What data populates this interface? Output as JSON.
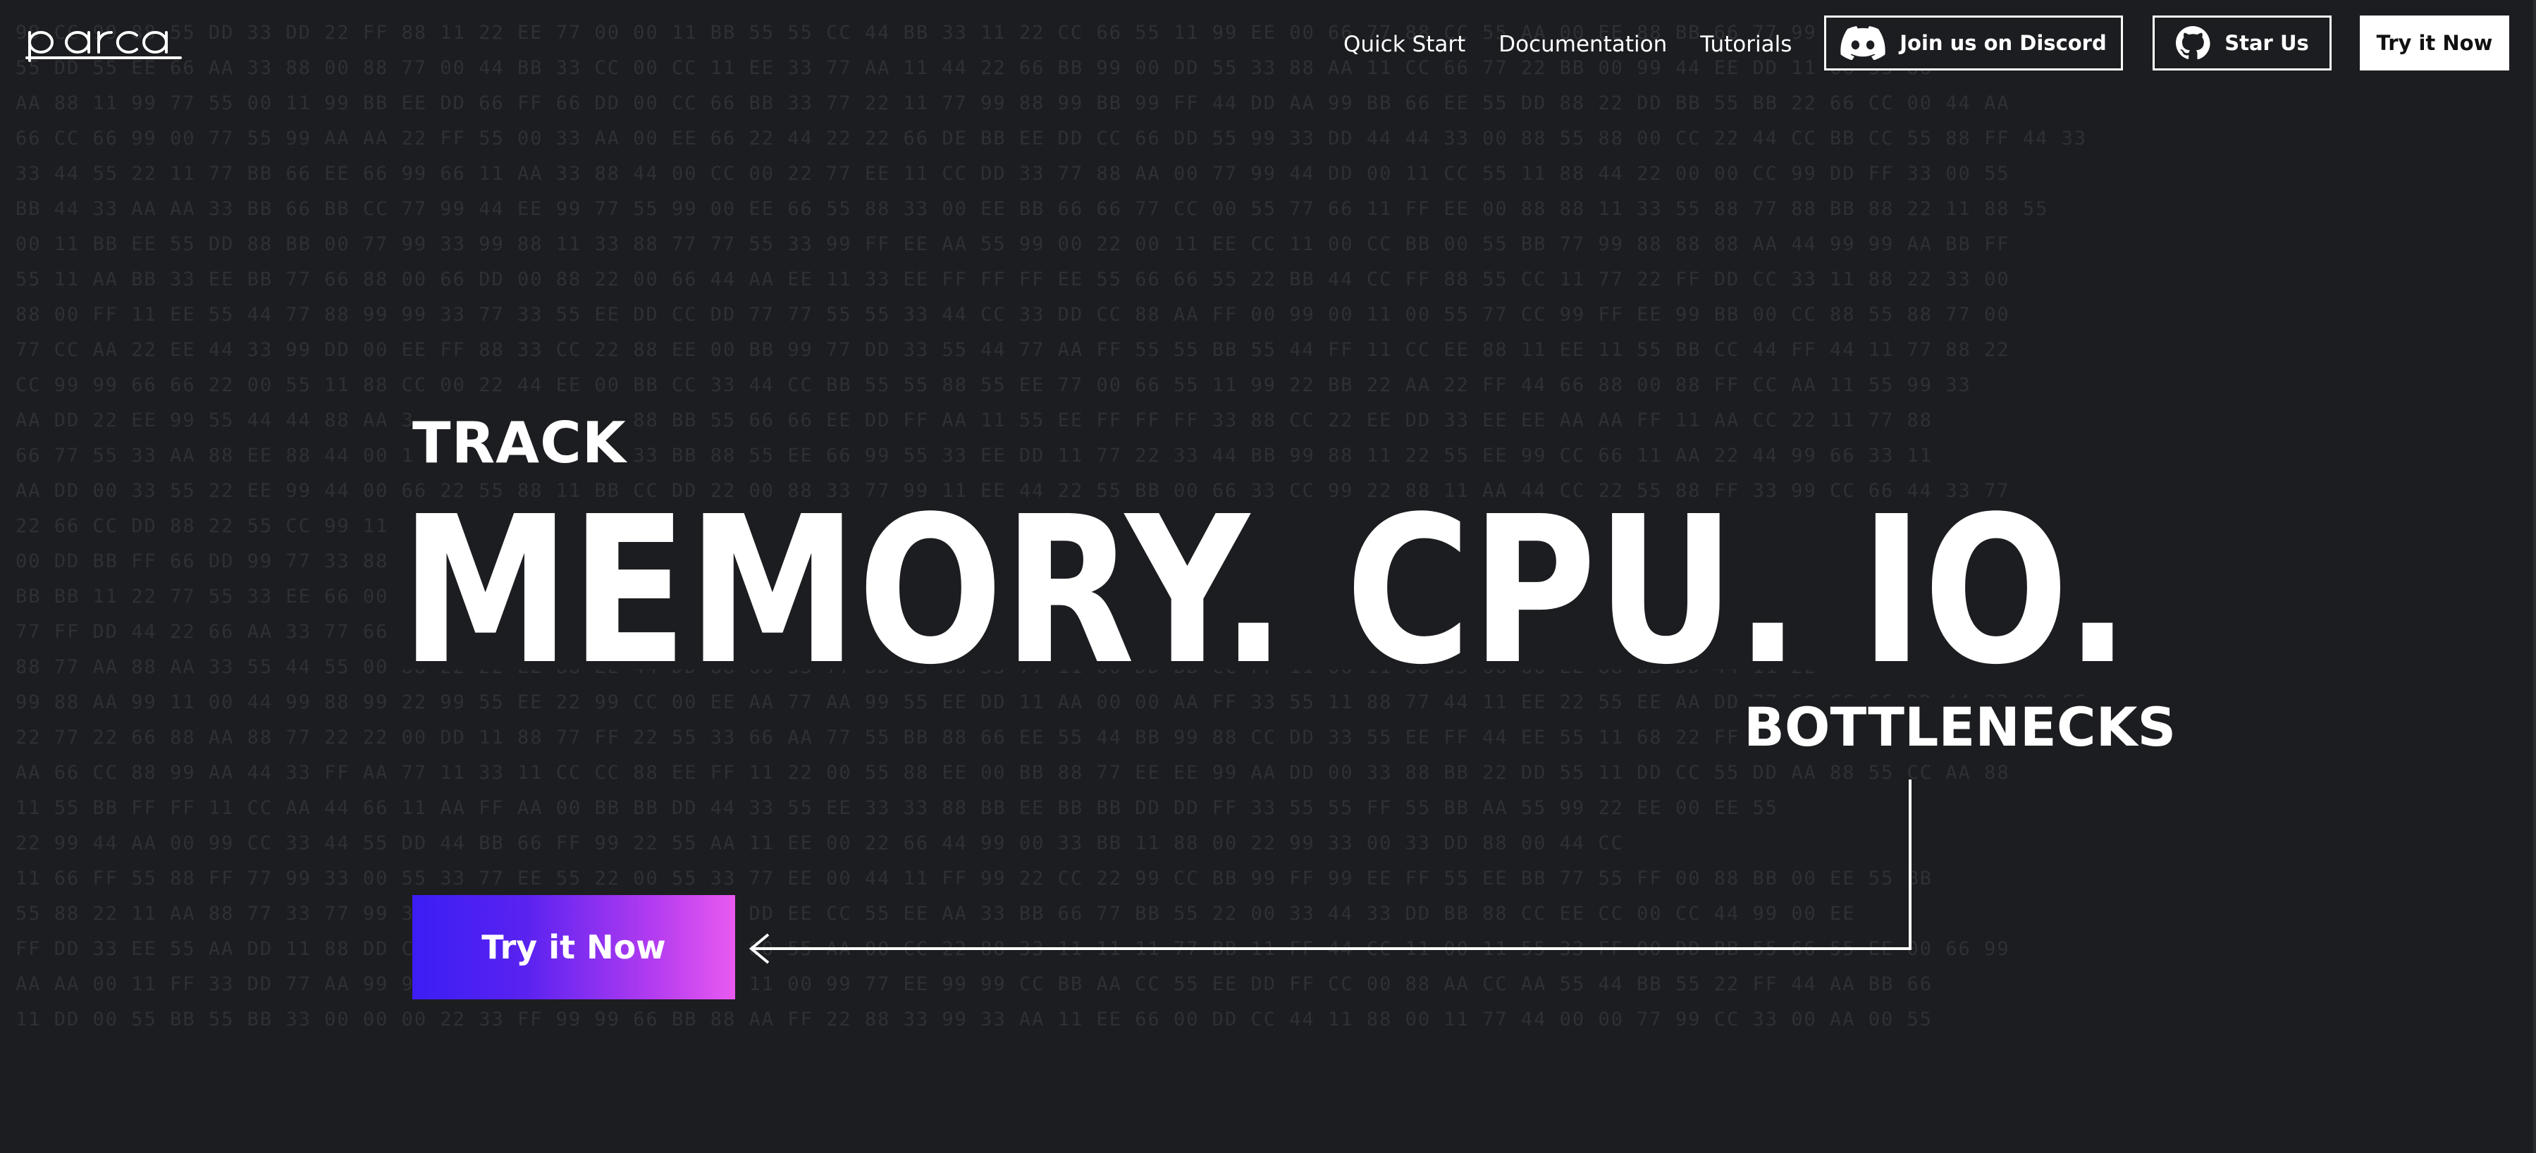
{
  "nav": {
    "logo_text": "parca",
    "links": [
      {
        "label": "Quick Start"
      },
      {
        "label": "Documentation"
      },
      {
        "label": "Tutorials"
      }
    ],
    "discord_label": "Join us on Discord",
    "star_label": "Star Us",
    "try_label": "Try it Now"
  },
  "hero": {
    "track": "TRACK",
    "headline": "MEMORY. CPU. IO.",
    "bottlenecks": "BOTTLENECKS",
    "cta_label": "Try it Now"
  },
  "colors": {
    "background": "#1c1d20",
    "hex_text": "#2e3034",
    "cta_gradient_start": "#3b1ef5",
    "cta_gradient_end": "#e95af0"
  },
  "background_hex_rows": [
    "99 CC 99 88 55 DD 33 DD 22 FF 88 11 22 EE 77 00 00 11 BB 55 55 CC 44 BB 33 11 22 CC 66 55 11 99 EE 00 66 77 88 CC 55 AA 00 EE 88 BB 66 77 99 22 00 11",
    "55 DD 55 EE 66 AA 33 88 00 88 77 00 44 BB 33 CC 00 CC 11 EE 33 77 AA 11 44 22 66 BB 99 00 DD 55 33 88 AA 11 CC 66 77 22 BB 00 99 44 EE DD 11 66 33 88",
    "AA 88 11 99 77 55 00 11 99 BB EE DD 66 FF 66 DD 00 CC 66 BB 33 77 22 11 77 99 88 99 BB 99 FF 44 DD AA 99 BB 66 EE 55 DD 88 22 DD BB 55 BB 22 66 CC 00 44 AA",
    "66 CC 66 99 00 77 55 99 AA AA 22 FF 55 00 33 AA 00 EE 66 22 44 22 22 66 DE BB EE DD CC 66 DD 55 99 33 DD 44 44 33 00 88 55 88 00 CC 22 44 CC BB CC 55 88 FF 44 33",
    "33 44 55 22 11 77 BB 66 EE 66 99 66 11 AA 33 88 44 00 CC 00 22 77 EE 11 CC DD 33 77 88 AA 00 77 99 44 DD 00 11 CC 55 11 88 44 22 00 00 CC 99 DD FF 33 00 55",
    "BB 44 33 AA AA 33 BB 66 BB CC 77 99 44 EE 99 77 55 99 00 EE 66 55 88 33 00 EE BB 66 66 77 CC 00 55 77 66 11 FF EE 00 88 88 11 33 55 88 77 88 BB 88 22 11 88 55",
    "00 11 BB EE 55 DD 88 BB 00 77 99 33 99 88 11 33 88 77 77 55 33 99 FF EE AA 55 99 00 22 00 11 EE CC 11 00 CC BB 00 55 BB 77 99 88 88 88 AA 44 99 99 AA BB FF",
    "55 11 AA BB 33 EE BB 77 66 88 00 66 DD 00 88 22 00 66 44 AA EE 11 33 EE FF FF FF EE 55 66 66 55 22 BB 44 CC FF 88 55 CC 11 77 22 FF DD CC 33 11 88 22 33 00",
    "88 00 FF 11 EE 55 44 77 88 99 99 33 77 33 55 EE DD CC DD 77 77 55 55 33 44 CC 33 DD CC 88 AA FF 00 99 00 11 00 55 77 CC 99 FF EE 99 BB 00 CC 88 55 88 77 00",
    "77 CC AA 22 EE 44 33 99 DD 00 EE FF 88 33 CC 22 88 EE 00 BB 99 77 DD 33 55 44 77 AA FF 55 55 BB 55 44 FF 11 CC EE 88 11 EE 11 55 BB CC 44 FF 44 11 77 88 22",
    "CC 99 99 66 66 22 00 55 11 88 CC 00 22 44 EE 00 BB CC 33 44 CC BB 55 55 88 55 EE 77 00 66 55 11 99 22 BB 22 AA 22 FF 44 66 88 00 88 FF CC AA 11 55 99 33",
    "AA DD 22 EE 99 55 44 44 88 AA 33 AA EE CC 22 55 88 BB 55 66 66 EE DD FF AA 11 55 EE FF FF FF 33 88 CC 22 EE DD 33 EE EE AA AA FF 11 AA CC 22 11 77 88",
    "66 77 55 33 AA 88 EE 88 44 00 11 99 55 EE 77 66 33 BB 88 55 EE 66 99 55 33 EE DD 11 77 22 33 44 BB 99 88 11 22 55 EE 99 CC 66 11 AA 22 44 99 66 33 11",
    "AA DD 00 33 55 22 EE 99 44 00 66 22 55 88 11 BB CC DD 22 00 88 33 77 99 11 EE 44 22 55 BB 00 66 33 CC 99 22 88 11 AA 44 CC 22 55 88 FF 33 99 CC 66 44 33 77",
    "22 66 CC DD 88 22 55 CC 99 11 44 88 EE 33 77 00 DD 66 22 AA 55 11 BB 88 33 CC 77 44 99 00 EE 55 22 88 66 11 33 DD 77 AA DD 88 AA FF 00 DD EE CC 33 11",
    "00 DD BB FF 66 DD 99 77 33 88 22 BB 11 55 CC 44 00 99 77 EE 22 66 AA 33 11 88 DD 55 00 CC 99 44 77 22 BB FF CC AA 44 FF CC AA BB DD AA 44 66 99 22",
    "BB BB 11 22 77 55 33 EE 66 00 44 99 11 CC 88 DD 55 22 AA 77 33 00 EE 66 BB 11 44 99 22 DD 88 55 00 CC 77 33 99 33 77 77 77 77 00 DD 55 22 88",
    "77 FF DD 44 22 66 AA 33 77 66 88 88 EE 33 EE 55 66 66 BB FF 88 11 CC CC 55 DD FF 11 44 11 22 88 77 DD 77 44 11 88 88 77 FF 88 44 44 DD 00 66 99",
    "88 77 AA 88 AA 33 55 44 55 00 88 22 22 EE 88 EE 44 DD 88 66 33 77 BB 55 66 33 77 11 00 DD BB CC FF 11 66 11 88 55 66 66 EE 88 BB DD 44 11 22",
    "99 88 AA 99 11 00 44 99 88 99 22 99 55 EE 22 99 CC 00 EE AA 77 AA 99 55 EE DD 11 AA 00 00 AA FF 33 55 11 88 77 44 11 EE 22 55 EE AA DD 77 66 CC 66 DD 44 22 88 CC",
    "22 77 22 66 88 AA 88 77 22 22 00 DD 11 88 77 FF 22 55 33 66 AA 77 55 BB 88 66 EE 55 44 BB 99 88 CC DD 33 55 EE FF 44 EE 55 11 68 22 FF DD 22 11 22 66 BB DD",
    "AA 66 CC 88 99 AA 44 33 FF AA 77 11 33 11 CC CC 88 EE FF 11 22 00 55 88 EE 00 BB 88 77 EE EE 99 AA DD 00 33 88 BB 22 DD 55 11 DD CC 55 DD AA 88 55 CC AA 88",
    "11 55 BB FF FF 11 CC AA 44 66 11 AA FF AA 00 BB BB DD 44 33 55 EE 33 33 88 BB EE BB BB DD DD FF 33 55 55 FF 55 BB AA 55 99 22 EE 00 EE 55",
    "22 99 44 AA 00 99 CC 33 44 55 DD 44 BB 66 FF 99 22 55 AA 11 EE 00 22 66 44 99 00 33 BB 11 88 00 22 99 33 00 33 DD 88 00 44 CC",
    "11 66 FF 55 88 FF 77 99 33 00 55 33 77 EE 55 22 00 55 33 77 EE 00 44 11 FF 99 22 CC 22 99 CC BB 99 FF 99 EE FF 55 EE BB 77 55 FF 00 88 BB 00 EE 55 BB",
    "55 88 22 11 AA 88 77 33 77 99 33 33 44 22 EE 00 88 FF 11 DD EE CC 55 EE AA 33 BB 66 77 BB 55 22 00 33 44 33 DD BB 88 CC EE CC 00 CC 44 99 00 EE",
    "FF DD 33 EE 55 AA DD 11 88 DD CC 55 CC FF CC CC 44 22 DD 00 55 AA 00 CC 22 88 33 11 11 11 77 BB 11 FF 44 CC 11 00 11 55 33 FF 00 DD BB 55 66 55 EE 00 66 99",
    "AA AA 00 11 FF 33 DD 77 AA 99 99 22 CC DD 99 33 11 77 00 11 00 99 77 EE 99 99 CC BB AA CC 55 EE DD FF CC 00 88 AA CC AA 55 44 BB 55 22 FF 44 AA BB 66",
    "11 DD 00 55 BB 55 BB 33 00 00 00 22 33 FF 99 99 66 BB 88 AA FF 22 88 33 99 33 AA 11 EE 66 00 DD CC 44 11 88 00 11 77 44 00 00 77 99 CC 33 00 AA 00 55"
  ]
}
